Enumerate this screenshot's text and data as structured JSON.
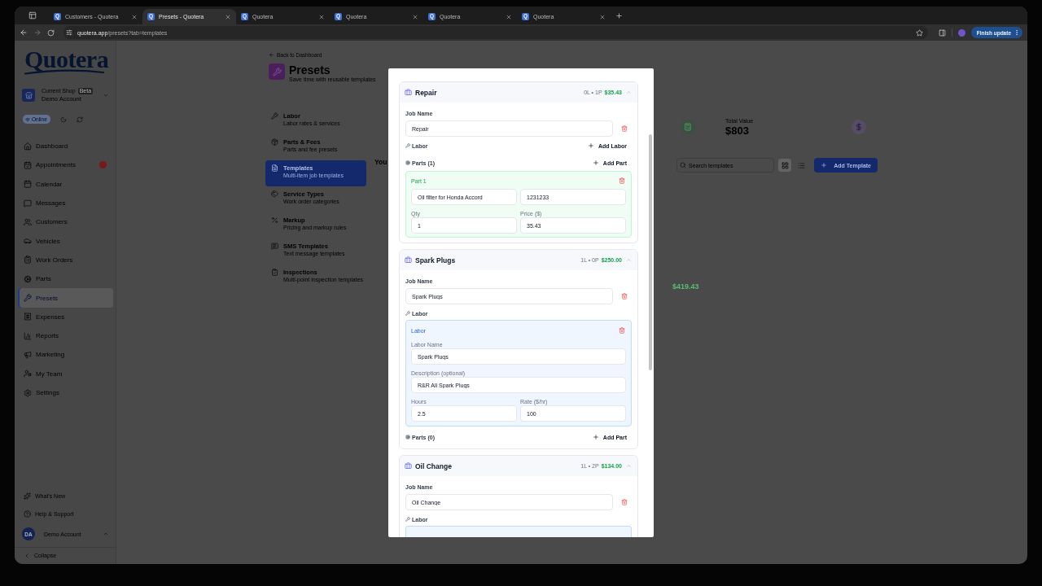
{
  "browser": {
    "tabs": [
      {
        "favicon": "Q",
        "title": "Customers - Quotera",
        "selected": false
      },
      {
        "favicon": "Q",
        "title": "Presets - Quotera",
        "selected": true
      },
      {
        "favicon": "Q",
        "title": "Quotera",
        "selected": false
      },
      {
        "favicon": "Q",
        "title": "Quotera",
        "selected": false
      },
      {
        "favicon": "Q",
        "title": "Quotera",
        "selected": false
      },
      {
        "favicon": "Q",
        "title": "Quotera",
        "selected": false
      }
    ],
    "address": {
      "host": "quotera.app",
      "path": "/presets?tab=templates"
    },
    "update_button": "Finish update"
  },
  "sidebar": {
    "logo": "Quotera",
    "shop": {
      "caption": "Current Shop",
      "badge": "Beta",
      "name": "Demo Account"
    },
    "status": "Online",
    "nav": [
      {
        "label": "Dashboard",
        "selected": false,
        "alert": false
      },
      {
        "label": "Appointments",
        "selected": false,
        "alert": true
      },
      {
        "label": "Calendar",
        "selected": false,
        "alert": false
      },
      {
        "label": "Messages",
        "selected": false,
        "alert": false
      },
      {
        "label": "Customers",
        "selected": false,
        "alert": false
      },
      {
        "label": "Vehicles",
        "selected": false,
        "alert": false
      },
      {
        "label": "Work Orders",
        "selected": false,
        "alert": false
      },
      {
        "label": "Parts",
        "selected": false,
        "alert": false
      },
      {
        "label": "Presets",
        "selected": true,
        "alert": false
      },
      {
        "label": "Expenses",
        "selected": false,
        "alert": false
      },
      {
        "label": "Reports",
        "selected": false,
        "alert": false
      },
      {
        "label": "Marketing",
        "selected": false,
        "alert": false
      },
      {
        "label": "My Team",
        "selected": false,
        "alert": false
      },
      {
        "label": "Settings",
        "selected": false,
        "alert": false
      }
    ],
    "footer_links": [
      "What's New",
      "Help & Support"
    ],
    "user": {
      "initials": "DA",
      "name": "Demo Account"
    },
    "collapse": "Collapse"
  },
  "page": {
    "back_link": "Back to Dashboard",
    "title": "Presets",
    "subtitle": "Save time with reusable templates",
    "sections": [
      {
        "title": "Labor",
        "subtitle": "Labor rates & services",
        "selected": false
      },
      {
        "title": "Parts & Fees",
        "subtitle": "Parts and fee presets",
        "selected": false
      },
      {
        "title": "Templates",
        "subtitle": "Multi-item job templates",
        "selected": true
      },
      {
        "title": "Service Types",
        "subtitle": "Work order categories",
        "selected": false
      },
      {
        "title": "Markup",
        "subtitle": "Pricing and markup rules",
        "selected": false
      },
      {
        "title": "SMS Templates",
        "subtitle": "Text message templates",
        "selected": false
      },
      {
        "title": "Inspections",
        "subtitle": "Multi-point inspection templates",
        "selected": false
      }
    ],
    "heading_fragment": "You",
    "total_value": {
      "label": "Total Value",
      "value": "$803"
    },
    "search": {
      "placeholder": "Search templates"
    },
    "view_modes": [
      {
        "kind": "grid",
        "selected": true
      },
      {
        "kind": "list",
        "selected": false
      }
    ],
    "add_button": "Add Template",
    "template_price": "$419.43"
  },
  "modal": {
    "jobs": [
      {
        "name": "Repair",
        "summary": "0L • 1P",
        "total": "$35.43",
        "expanded": true,
        "job_name_label": "Job Name",
        "job_name": "Repair",
        "labor_label": "Labor",
        "add_labor": "Add Labor",
        "parts_label": "Parts (1)",
        "add_part": "Add Part",
        "parts": [
          {
            "title": "Part 1",
            "name": "Oil filter for Honda Accord",
            "number": "1231233",
            "qty_label": "Qty",
            "qty": "1",
            "price_label": "Price ($)",
            "price": "35.43"
          }
        ],
        "labor_cut": false
      },
      {
        "name": "Spark Plugs",
        "summary": "1L • 0P",
        "total": "$250.00",
        "expanded": true,
        "job_name_label": "Job Name",
        "job_name": "Spark Plugs",
        "labor_label": "Labor",
        "labor": [
          {
            "title": "Labor",
            "name_label": "Labor Name",
            "name": "Spark Plugs",
            "description_label": "Description (optional)",
            "description": "R&R All Spark Plugs",
            "hours_label": "Hours",
            "hours": "2.5",
            "rate_label": "Rate ($/hr)",
            "rate": "100"
          }
        ],
        "parts_label": "Parts (0)",
        "add_part": "Add Part",
        "labor_cut": false
      },
      {
        "name": "Oil Change",
        "summary": "1L • 2P",
        "total": "$134.00",
        "expanded": true,
        "job_name_label": "Job Name",
        "job_name": "Oil Change",
        "labor_label": "Labor",
        "labor_cut": true
      }
    ]
  }
}
